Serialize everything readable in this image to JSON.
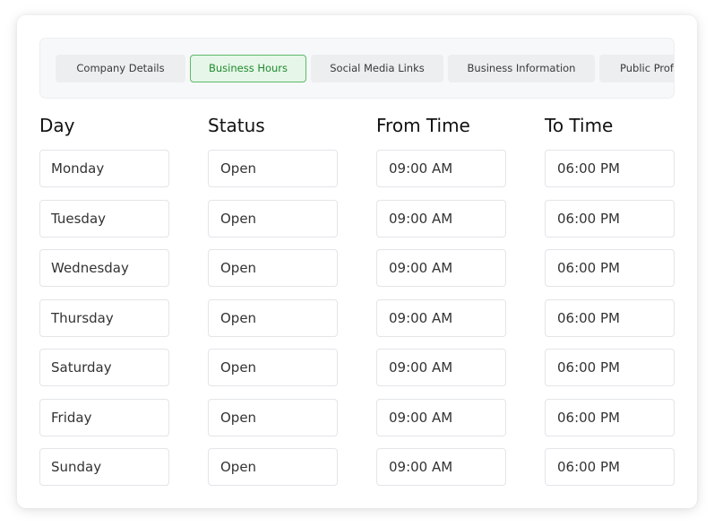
{
  "tabs": [
    {
      "label": "Company Details",
      "active": false
    },
    {
      "label": "Business Hours",
      "active": true
    },
    {
      "label": "Social Media Links",
      "active": false
    },
    {
      "label": "Business Information",
      "active": false
    },
    {
      "label": "Public Prof",
      "active": false
    }
  ],
  "columns": {
    "day": "Day",
    "status": "Status",
    "from": "From Time",
    "to": "To Time"
  },
  "rows": [
    {
      "day": "Monday",
      "status": "Open",
      "from": "09:00 AM",
      "to": "06:00 PM"
    },
    {
      "day": "Tuesday",
      "status": "Open",
      "from": "09:00 AM",
      "to": "06:00 PM"
    },
    {
      "day": "Wednesday",
      "status": "Open",
      "from": "09:00 AM",
      "to": "06:00 PM"
    },
    {
      "day": "Thursday",
      "status": "Open",
      "from": "09:00 AM",
      "to": "06:00 PM"
    },
    {
      "day": "Saturday",
      "status": "Open",
      "from": "09:00 AM",
      "to": "06:00 PM"
    },
    {
      "day": "Friday",
      "status": "Open",
      "from": "09:00 AM",
      "to": "06:00 PM"
    },
    {
      "day": "Sunday",
      "status": "Open",
      "from": "09:00 AM",
      "to": "06:00 PM"
    }
  ],
  "colors": {
    "active_tab_bg": "#e6f6e8",
    "active_tab_border": "#5cb96a",
    "active_tab_text": "#1e8a2e"
  }
}
